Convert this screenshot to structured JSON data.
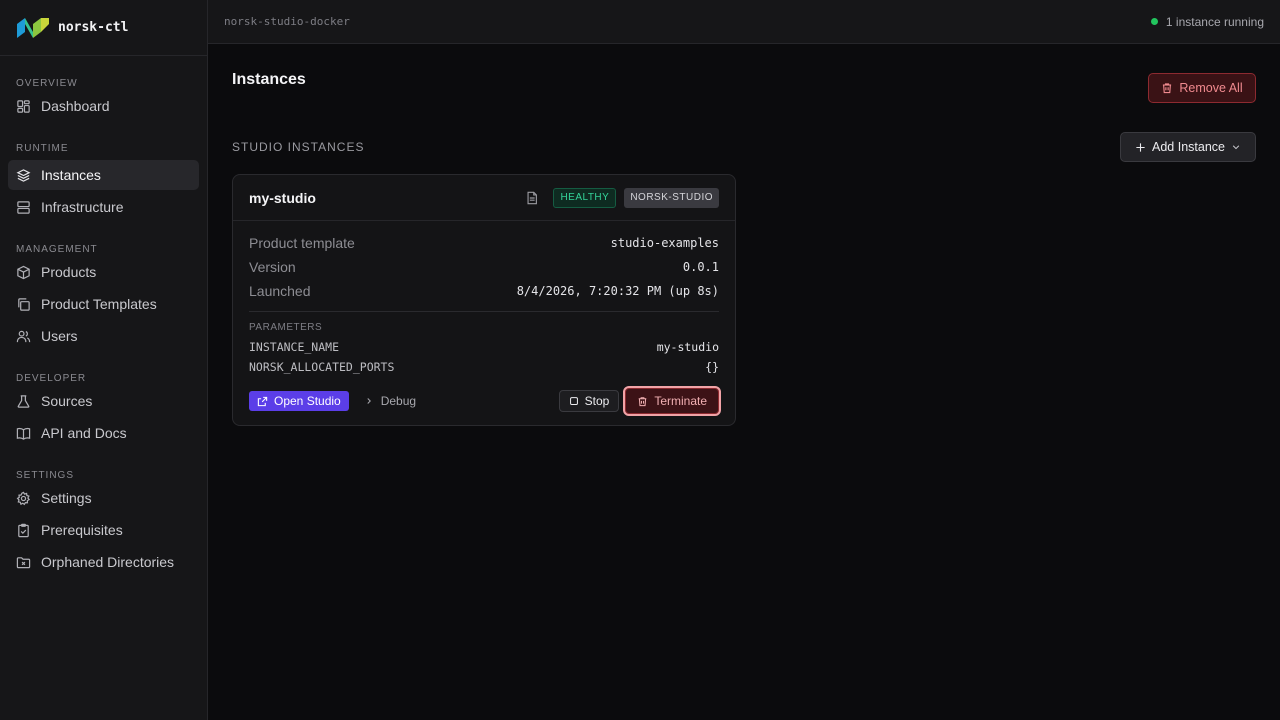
{
  "app": {
    "name": "norsk-ctl",
    "logo_icon": "norsk-logo-icon",
    "accent_color": "#5b3ee8"
  },
  "topbar": {
    "context": "norsk-studio-docker",
    "status_text": "1 instance running",
    "status_color": "#22c55e"
  },
  "sidebar": {
    "sections": [
      {
        "title": "OVERVIEW",
        "items": [
          {
            "label": "Dashboard",
            "icon": "dashboard-icon"
          }
        ]
      },
      {
        "title": "RUNTIME",
        "items": [
          {
            "label": "Instances",
            "icon": "layers-icon",
            "active": true
          },
          {
            "label": "Infrastructure",
            "icon": "server-icon"
          }
        ]
      },
      {
        "title": "MANAGEMENT",
        "items": [
          {
            "label": "Products",
            "icon": "package-icon"
          },
          {
            "label": "Product Templates",
            "icon": "copy-icon"
          },
          {
            "label": "Users",
            "icon": "users-icon"
          }
        ]
      },
      {
        "title": "DEVELOPER",
        "items": [
          {
            "label": "Sources",
            "icon": "flask-icon"
          },
          {
            "label": "API and Docs",
            "icon": "book-icon"
          }
        ]
      },
      {
        "title": "SETTINGS",
        "items": [
          {
            "label": "Settings",
            "icon": "gear-icon"
          },
          {
            "label": "Prerequisites",
            "icon": "clipboard-check-icon"
          },
          {
            "label": "Orphaned Directories",
            "icon": "folder-x-icon"
          }
        ]
      }
    ]
  },
  "main": {
    "title": "Instances",
    "remove_all_label": "Remove All",
    "section_title": "STUDIO INSTANCES",
    "add_instance_label": "Add Instance"
  },
  "instance": {
    "name": "my-studio",
    "health_badge": "HEALTHY",
    "type_badge": "NORSK-STUDIO",
    "details": [
      {
        "label": "Product template",
        "value": "studio-examples"
      },
      {
        "label": "Version",
        "value": "0.0.1"
      },
      {
        "label": "Launched",
        "value": "8/4/2026, 7:20:32 PM (up 8s)"
      }
    ],
    "parameters_title": "PARAMETERS",
    "parameters": [
      {
        "key": "INSTANCE_NAME",
        "value": "my-studio"
      },
      {
        "key": "NORSK_ALLOCATED_PORTS",
        "value": "{}"
      }
    ],
    "actions": {
      "open_label": "Open Studio",
      "debug_label": "Debug",
      "stop_label": "Stop",
      "terminate_label": "Terminate"
    }
  }
}
